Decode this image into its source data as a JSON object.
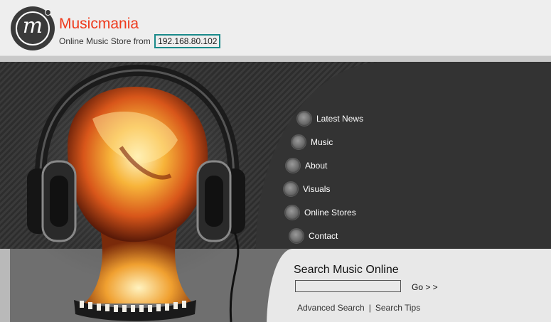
{
  "header": {
    "logo_letter": "m",
    "site_title": "Musicmania",
    "tagline_prefix": "Online Music Store from",
    "ip_address": "192.168.80.102"
  },
  "nav": {
    "items": [
      {
        "label": "Latest News"
      },
      {
        "label": "Music"
      },
      {
        "label": "About"
      },
      {
        "label": "Visuals"
      },
      {
        "label": "Online Stores"
      },
      {
        "label": "Contact"
      }
    ]
  },
  "search": {
    "title": "Search Music Online",
    "input_value": "",
    "go_label": "Go > >",
    "advanced_label": "Advanced Search",
    "separator": "|",
    "tips_label": "Search Tips"
  },
  "colors": {
    "brand_red": "#ee3a1c",
    "ip_highlight": "#1a8a8a",
    "panel_dark": "#333333"
  }
}
